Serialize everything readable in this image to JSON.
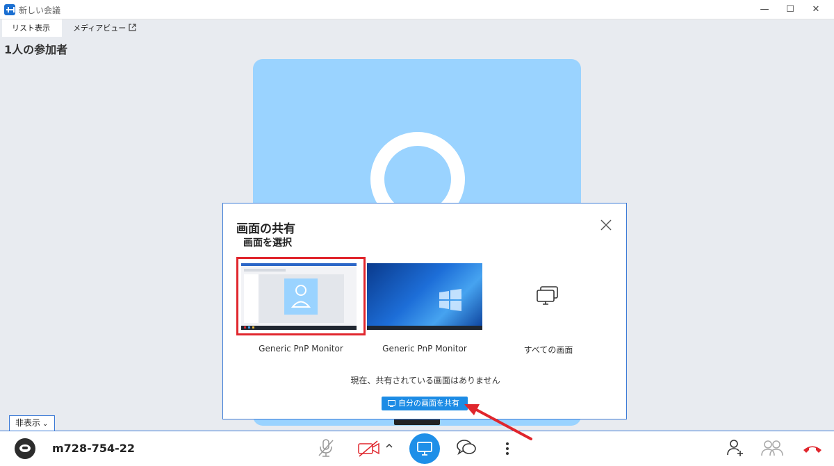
{
  "window": {
    "title": "新しい会議",
    "minimize": "—",
    "maximize": "☐",
    "close": "✕"
  },
  "tabs": [
    {
      "label": "リスト表示",
      "active": true
    },
    {
      "label": "メディアビュー",
      "active": false
    }
  ],
  "participants_title": "1人の参加者",
  "dialog": {
    "title": "画面の共有",
    "subtitle": "画面を選択",
    "screens": [
      {
        "label": "Generic PnP Monitor",
        "selected": true
      },
      {
        "label": "Generic PnP Monitor",
        "selected": false
      }
    ],
    "all_screens_label": "すべての画面",
    "status_text": "現在、共有されている画面はありません",
    "share_button": "自分の画面を共有"
  },
  "bottom": {
    "hide_label": "非表示",
    "meeting_id": "m728-754-22"
  },
  "colors": {
    "accent": "#1e8fe8",
    "selection_border": "#e0262d",
    "tile_background": "#9ad3ff",
    "hangup": "#e0262d"
  }
}
